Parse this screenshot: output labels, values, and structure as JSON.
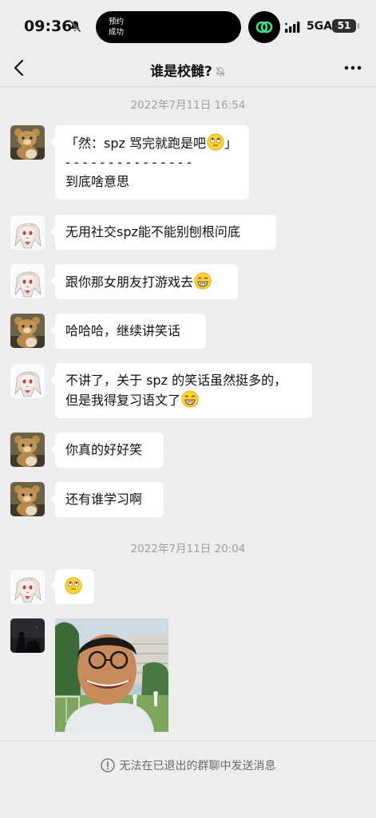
{
  "status_bar": {
    "time": "09:36",
    "island_line1": "预约",
    "island_line2": "成功",
    "network": "5GA",
    "battery": "51"
  },
  "header": {
    "title": "谁是校雠?"
  },
  "timestamps": [
    "2022年7月11日 16:54",
    "2022年7月11日 20:04"
  ],
  "messages": [
    {
      "sender": "bear",
      "lines": [
        "「然：spz 骂完就跑是吧",
        "」"
      ],
      "separator": "- - - - - - - - - - - - - - -",
      "extra": "到底啥意思"
    },
    {
      "sender": "anime",
      "text": "无用社交spz能不能别刨根问底"
    },
    {
      "sender": "anime",
      "text": "跟你那女朋友打游戏去"
    },
    {
      "sender": "bear",
      "text": "哈哈哈，继续讲笑话"
    },
    {
      "sender": "anime",
      "line1": "不讲了，关于 spz 的笑话虽然挺多的，",
      "line2": "但是我得复习语文了"
    },
    {
      "sender": "bear",
      "text": "你真的好好笑"
    },
    {
      "sender": "bear",
      "text": "还有谁学习啊"
    },
    {
      "sender": "anime",
      "text": ""
    },
    {
      "sender": "dark",
      "type": "image"
    }
  ],
  "footer": {
    "notice": "无法在已退出的群聊中发送消息"
  },
  "icons": [
    "bell-off-icon",
    "back-icon",
    "mute-icon",
    "more-icon",
    "info-icon",
    "eyeroll-emoji-icon",
    "grin-emoji-icon"
  ]
}
